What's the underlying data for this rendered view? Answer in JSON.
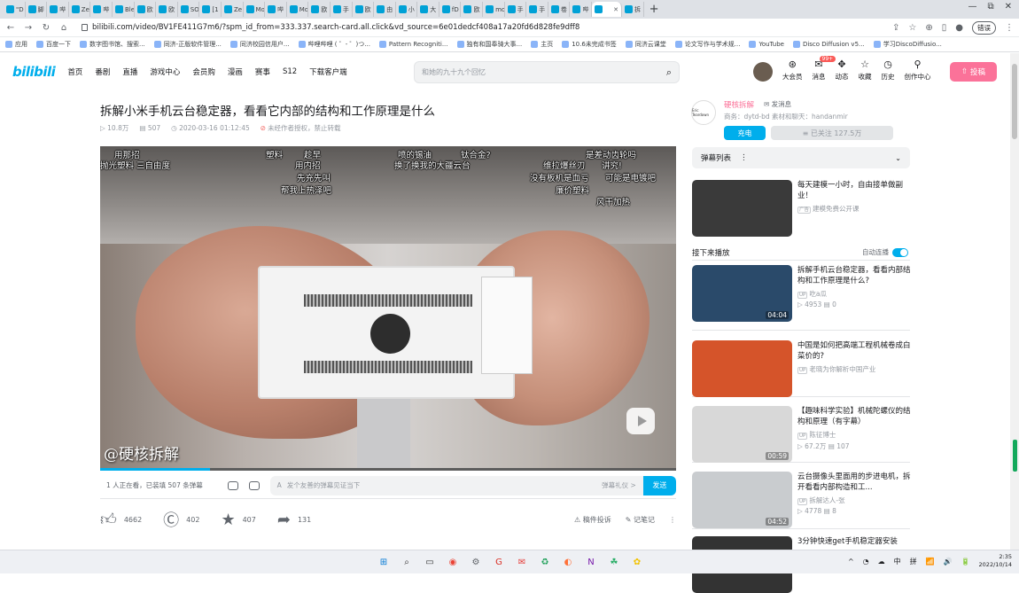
{
  "browser": {
    "tabs": [
      "\"D",
      "脚",
      "哔",
      "Ze",
      "哔",
      "Ble",
      "欧",
      "欧",
      "SO",
      "[1",
      "Ze",
      "Mo",
      "哔",
      "Mo",
      "欧",
      "手",
      "欧",
      "由",
      "小",
      "大",
      "fD",
      "欧",
      "mo",
      "手",
      "手",
      "卷",
      "哔",
      "",
      "拆"
    ],
    "active_tab_index": 27,
    "window_controls": [
      "—",
      "⧉",
      "✕"
    ],
    "url": "bilibili.com/video/BV1FE411G7m6/?spm_id_from=333.337.search-card.all.click&vd_source=6e01dedcf408a17a20fd6d828fe9dff8",
    "profile_pill": "错误",
    "bookmarks": [
      "应用",
      "百度一下",
      "数字图书馆、搜索...",
      "同济-正版软件管理...",
      "同济校园信用户...",
      "哔哩哔哩 ( ゜- ゜)つ...",
      "Pattern Recogniti...",
      "独有和国奉骑大事...",
      "主页",
      "10.6未完成书签",
      "同济云课堂",
      "论文写作与学术规...",
      "YouTube",
      "Disco Diffusion v5...",
      "学习DiscoDiffusio..."
    ]
  },
  "header": {
    "logo": "bilibili",
    "nav": [
      "首页",
      "番剧",
      "直播",
      "游戏中心",
      "会员购",
      "漫画",
      "赛事",
      "S12",
      "下载客户端"
    ],
    "search_placeholder": "和她的九十九个回忆",
    "icons": [
      {
        "label": "大会员",
        "icon": "vip-icon",
        "glyph": "⊛"
      },
      {
        "label": "消息",
        "icon": "message-icon",
        "glyph": "✉",
        "badge": "99+"
      },
      {
        "label": "动态",
        "icon": "dynamic-icon",
        "glyph": "✥"
      },
      {
        "label": "收藏",
        "icon": "favorite-icon",
        "glyph": "☆"
      },
      {
        "label": "历史",
        "icon": "history-icon",
        "glyph": "◷"
      },
      {
        "label": "创作中心",
        "icon": "creator-icon",
        "glyph": "⚲"
      }
    ],
    "upload_label": "投稿"
  },
  "video": {
    "title": "拆解小米手机云台稳定器，看看它内部的结构和工作原理是什么",
    "plays": "10.8万",
    "danmaku_count": "507",
    "date": "2020-03-16 01:12:45",
    "notice": "未经作者授权，禁止转载",
    "watermark": "@硬核拆解",
    "progress_fraction": 0.19,
    "danmaku": [
      "用那招",
      "抛光塑料  三自由度",
      "塑料",
      "趁早",
      "用内招",
      "先充先叫",
      "帮我上热泽吧",
      "喷的锡油",
      "钛合金?",
      "换了换我的大疆云台",
      "是差动齿轮吗",
      "维拉爆丝刃",
      "讲究!",
      "没有板机是血亏",
      "可能是电镀吧",
      "廉价塑料",
      "风干加热"
    ]
  },
  "danmaku_bar": {
    "watching": "1 人正在看，已装填 507 条弹幕",
    "input_placeholder": "发个友善的弹幕见证当下",
    "etiquette": "弹幕礼仪 >",
    "send": "发送"
  },
  "actions": {
    "like": "4662",
    "coin": "402",
    "favorite": "407",
    "share": "131",
    "report": "稿件投诉",
    "notes": "记笔记",
    "more": "⋮"
  },
  "uploader": {
    "avatar_text": "Eric Teardown",
    "name": "硬核拆解",
    "message": "发消息",
    "desc": "商务：dytd-bd 素材和聊天：handanmir",
    "charge": "充电",
    "follow": "≡ 已关注 127.5万"
  },
  "danmaku_list": {
    "label": "弹幕列表",
    "more": "⋮",
    "chevron": "⌄"
  },
  "ad": {
    "title": "每天建模一小时，自由接单做副业！",
    "tag": "广告",
    "source": "建模免费公开课"
  },
  "up_next": {
    "label": "接下来播放",
    "autoplay": "自动连播"
  },
  "recommendations": [
    {
      "title": "拆解手机云台稳定器，看看内部结构和工作原理是什么?",
      "up": "吃a瓜",
      "plays": "4953",
      "danmaku": "0",
      "duration": "04:04",
      "color": "#2a4a6a"
    },
    {
      "title": "中国是如何把高端工程机械卷成白菜价的?",
      "up": "老晓为你解析中国产业",
      "plays": "",
      "danmaku": "",
      "duration": "",
      "color": "#d5542a"
    },
    {
      "title": "【趣味科学实验】机械陀螺仪的结构和原理（有字幕）",
      "up": "陈征博士",
      "plays": "67.2万",
      "danmaku": "107",
      "duration": "00:59",
      "color": "#d8d8d8"
    },
    {
      "title": "云台摄像头里面用的步进电机，拆开看看内部构造和工...",
      "up": "拆解达人-张",
      "plays": "4778",
      "danmaku": "8",
      "duration": "04:52",
      "color": "#c9cccf"
    },
    {
      "title": "3分钟快速get手机稳定器安装",
      "up": "",
      "plays": "",
      "danmaku": "",
      "duration": "",
      "color": "#333"
    }
  ],
  "taskbar": {
    "apps": [
      "⊞",
      "⌕",
      "▭",
      "◉",
      "⚙",
      "G",
      "✉",
      "♻",
      "◐",
      "N",
      "☘",
      "✿"
    ],
    "tray": [
      "^",
      "◔",
      "☁",
      "中",
      "拼",
      "📶",
      "🔊",
      "🔋"
    ],
    "time": "2:35",
    "date": "2022/10/14"
  }
}
